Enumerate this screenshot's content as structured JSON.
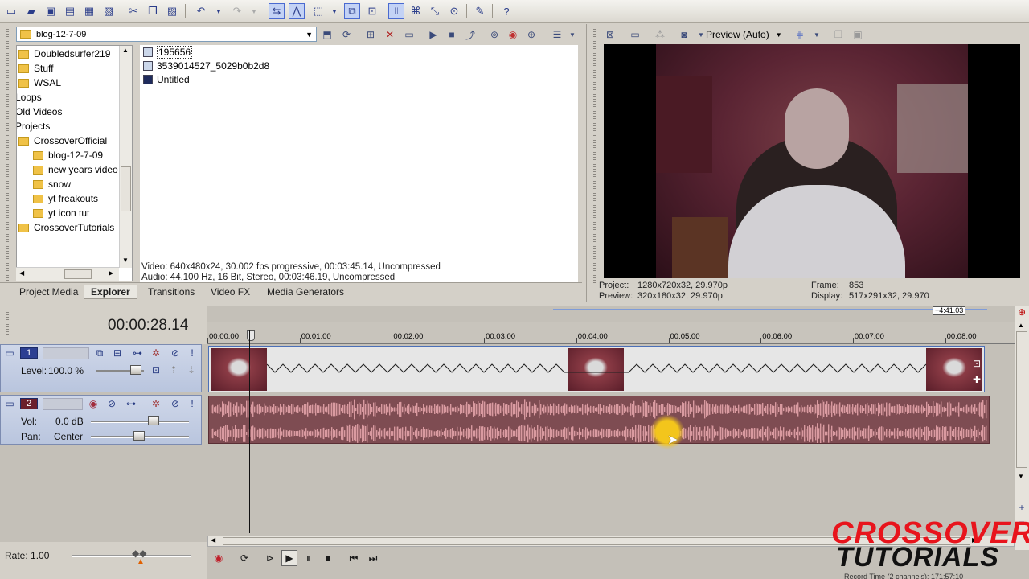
{
  "toolbar": {
    "icons": [
      "new-icon",
      "open-icon",
      "save-icon",
      "save-as-icon",
      "render-icon",
      "properties-icon",
      "cut-icon",
      "copy-icon",
      "paste-icon",
      "undo-icon",
      "redo-icon",
      "normal-edit-icon",
      "envelope-edit-icon",
      "selection-edit-icon",
      "zoom-edit-icon",
      "auto-ripple-icon",
      "lock-envelopes-icon",
      "ignore-grouping-icon",
      "auto-crossfade-icon",
      "snapping-icon",
      "markers-icon",
      "help-icon"
    ]
  },
  "explorer": {
    "path": "blog-12-7-09",
    "tree": [
      {
        "label": "Doubledsurfer219",
        "indent": 0,
        "folder": true
      },
      {
        "label": "Stuff",
        "indent": 0,
        "folder": true
      },
      {
        "label": "WSAL",
        "indent": 0,
        "folder": true
      },
      {
        "label": "Loops",
        "indent": -1,
        "folder": false
      },
      {
        "label": "Old Videos",
        "indent": -1,
        "folder": false
      },
      {
        "label": "Projects",
        "indent": -1,
        "folder": false
      },
      {
        "label": "CrossoverOfficial",
        "indent": 0,
        "folder": true
      },
      {
        "label": "blog-12-7-09",
        "indent": 1,
        "folder": true
      },
      {
        "label": "new years video",
        "indent": 1,
        "folder": true
      },
      {
        "label": "snow",
        "indent": 1,
        "folder": true
      },
      {
        "label": "yt freakouts",
        "indent": 1,
        "folder": true
      },
      {
        "label": "yt icon tut",
        "indent": 1,
        "folder": true
      },
      {
        "label": "CrossoverTutorials",
        "indent": 0,
        "folder": true
      }
    ],
    "files": [
      {
        "name": "195656",
        "selected": true
      },
      {
        "name": "3539014527_5029b0b2d8",
        "selected": false
      },
      {
        "name": "Untitled",
        "selected": false
      }
    ],
    "info_video": "Video: 640x480x24, 30.002 fps progressive, 00:03:45.14, Uncompressed",
    "info_audio": "Audio: 44,100 Hz, 16 Bit, Stereo, 00:03:46.19, Uncompressed",
    "tabs": [
      "Project Media",
      "Explorer",
      "Transitions",
      "Video FX",
      "Media Generators"
    ],
    "active_tab": "Explorer"
  },
  "preview": {
    "mode": "Preview (Auto)",
    "project_label": "Project:",
    "project_value": "1280x720x32, 29.970p",
    "preview_label": "Preview:",
    "preview_value": "320x180x32, 29.970p",
    "frame_label": "Frame:",
    "frame_value": "853",
    "display_label": "Display:",
    "display_value": "517x291x32, 29.970"
  },
  "timeline": {
    "timecode": "00:00:28.14",
    "end_marker": "+4:41.03",
    "ruler": [
      "00:00:00",
      "00:01:00",
      "00:02:00",
      "00:03:00",
      "00:04:00",
      "00:05:00",
      "00:06:00",
      "00:07:00",
      "00:08:00"
    ],
    "video_track": {
      "number": "1",
      "level_label": "Level:",
      "level_value": "100.0 %"
    },
    "audio_track": {
      "number": "2",
      "vol_label": "Vol:",
      "vol_value": "0.0 dB",
      "pan_label": "Pan:",
      "pan_value": "Center"
    },
    "rate": "Rate: 1.00"
  },
  "watermark": {
    "line1": "CROSSOVER",
    "line2": "TUTORIALS"
  },
  "status": "Record Time (2 channels): 171:57:10",
  "colors": {
    "video_track_border": "#4b6fb7",
    "audio_clip": "#7e4c52",
    "waveform": "#d99aa0",
    "watermark_red": "#e8141c"
  }
}
